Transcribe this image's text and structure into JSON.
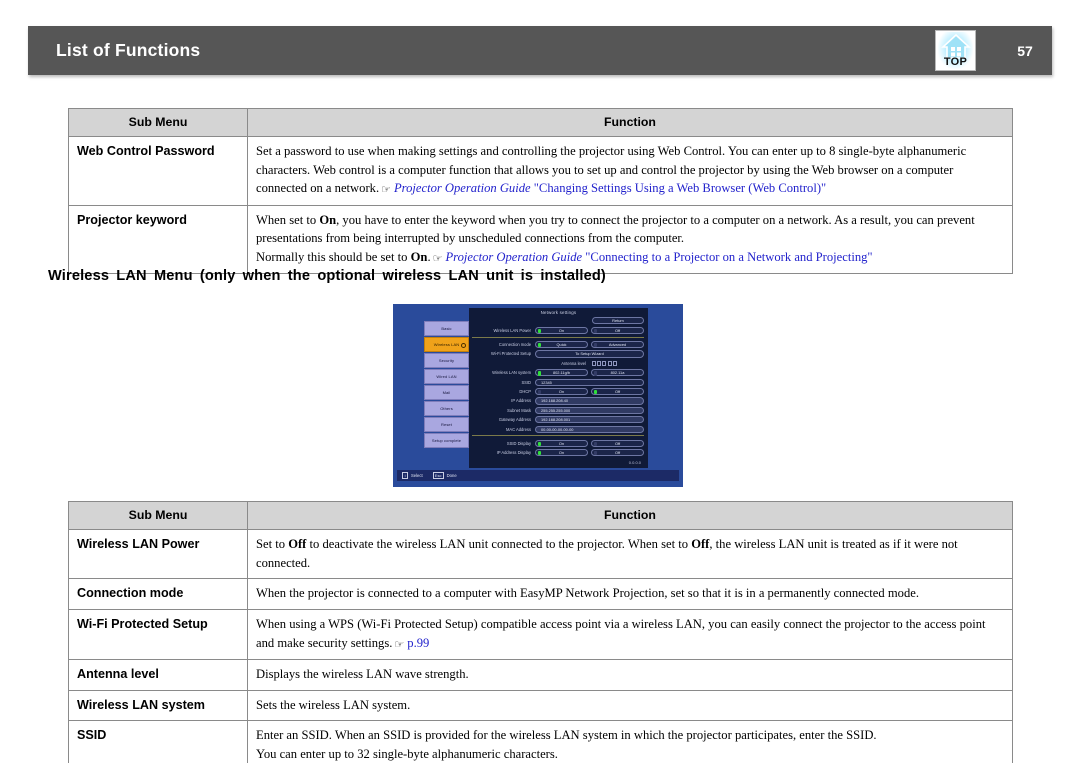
{
  "header": {
    "title": "List of Functions",
    "page_number": "57",
    "top_icon_label": "TOP",
    "bar_color": "#565656"
  },
  "table1": {
    "headers": [
      "Sub Menu",
      "Function"
    ],
    "rows": [
      {
        "submenu": "Web Control Password",
        "lines": [
          "Set a password to use when making settings and controlling the projector using Web Control. You can enter up to 8 single-byte alphanumeric",
          "characters. Web control is a computer function that allows you to set up and control the projector by using the Web browser on a computer",
          "connected on a network."
        ],
        "link_italic": "Projector Operation Guide",
        "link_plain": "\"Changing Settings Using a Web Browser (Web Control)\""
      },
      {
        "submenu": "Projector keyword",
        "line1_a": "When set to ",
        "line1_b": "On",
        "line1_c": ", you have to enter the keyword when you try to connect the projector to a computer on a network. As a result, you can prevent",
        "line2": "presentations from being interrupted by unscheduled connections from the computer.",
        "line3_a": "Normally this should be set to ",
        "line3_b": "On",
        "line3_c": ".",
        "link_italic": "Projector Operation Guide",
        "link_plain": "\"Connecting to a Projector on a Network and Projecting\""
      }
    ]
  },
  "section_heading": "Wireless LAN Menu (only when the optional wireless LAN unit is installed)",
  "projector_screenshot": {
    "window_title": "Network settings",
    "return_button": "Return",
    "sidebar": [
      "Basic",
      "Wireless LAN",
      "Security",
      "Wired LAN",
      "Mail",
      "Others",
      "Reset",
      "Setup complete"
    ],
    "active_sidebar_item": "Wireless LAN",
    "settings": [
      {
        "label": "Wireless LAN Power",
        "opt1": "On",
        "opt2": "Off",
        "selected": 1
      },
      {
        "label": "Connection mode",
        "opt1": "Quick",
        "opt2": "Advanced",
        "selected": 1
      },
      {
        "label": "Wi-Fi Protected Setup",
        "full": "To Setup Wizard"
      },
      {
        "label": "Antenna level",
        "bars": 5
      },
      {
        "label": "Wireless LAN system",
        "opt1": "802.11g/b",
        "opt2": "802.11a",
        "selected": 1
      },
      {
        "label": "SSID",
        "field": "12345"
      },
      {
        "label": "DHCP",
        "opt1": "On",
        "opt2": "Off",
        "selected": 2
      },
      {
        "label": "IP Address",
        "field": "192.168.208.40"
      },
      {
        "label": "Subnet Mask",
        "field": "255.255.255.000"
      },
      {
        "label": "Gateway Address",
        "field": "192.168.208.001"
      },
      {
        "label": "MAC Address",
        "field": "00-00-00-00-00-00"
      },
      {
        "label": "SSID Display",
        "opt1": "On",
        "opt2": "Off",
        "selected": 1
      },
      {
        "label": "IP Address Display",
        "opt1": "On",
        "opt2": "Off",
        "selected": 1
      }
    ],
    "version": "0.0.0.0",
    "footer_keys": [
      {
        "key": "↕",
        "label": "Select"
      },
      {
        "key": "Esc",
        "label": "Done"
      }
    ]
  },
  "table2": {
    "headers": [
      "Sub Menu",
      "Function"
    ],
    "rows": [
      {
        "submenu": "Wireless LAN Power",
        "line_a": "Set to ",
        "line_b": "Off",
        "line_c": " to deactivate the wireless LAN unit connected to the projector. When set to ",
        "line_d": "Off",
        "line_e": ", the wireless LAN unit is treated as if it were not connected."
      },
      {
        "submenu": "Connection mode",
        "line": "When the projector is connected to a computer with EasyMP Network Projection, set so that it is in a permanently connected mode."
      },
      {
        "submenu": "Wi-Fi Protected Setup",
        "line1": "When using a WPS (Wi-Fi Protected Setup) compatible access point via a wireless LAN, you can easily connect the projector to the access point",
        "line2": "and make security settings.",
        "link": "p.99"
      },
      {
        "submenu": "Antenna level",
        "line": "Displays the wireless LAN wave strength."
      },
      {
        "submenu": "Wireless LAN system",
        "line": "Sets the wireless LAN system."
      },
      {
        "submenu": "SSID",
        "line1": "Enter an SSID. When an SSID is provided for the wireless LAN system in which the projector participates, enter the SSID.",
        "line2": "You can enter up to 32 single-byte alphanumeric characters."
      }
    ]
  }
}
